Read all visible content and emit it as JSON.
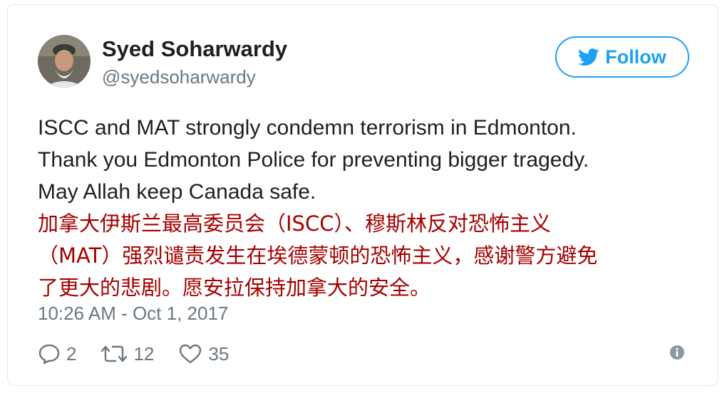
{
  "author": {
    "display_name": "Syed Soharwardy",
    "handle": "@syedsoharwardy"
  },
  "follow": {
    "label": "Follow"
  },
  "tweet": {
    "lines": [
      "ISCC and MAT strongly condemn terrorism in Edmonton.",
      "Thank you Edmonton Police for preventing bigger tragedy.",
      "May Allah keep Canada safe."
    ],
    "translation": "加拿大伊斯兰最高委员会（ISCC）、穆斯林反对恐怖主义\n（MAT）强烈谴责发生在埃德蒙顿的恐怖主义，感谢警方避免\n了更大的悲剧。愿安拉保持加拿大的安全。"
  },
  "timestamp": "10:26 AM - Oct 1, 2017",
  "actions": {
    "reply_count": "2",
    "retweet_count": "12",
    "like_count": "35"
  },
  "colors": {
    "accent": "#1da1f2",
    "translation": "#a50000",
    "muted": "#697882",
    "text": "#1c2022",
    "border": "#e1e8ed"
  },
  "icons": {
    "follow": "twitter-bird-icon",
    "reply": "reply-icon",
    "retweet": "retweet-icon",
    "like": "heart-icon",
    "info": "info-icon"
  }
}
